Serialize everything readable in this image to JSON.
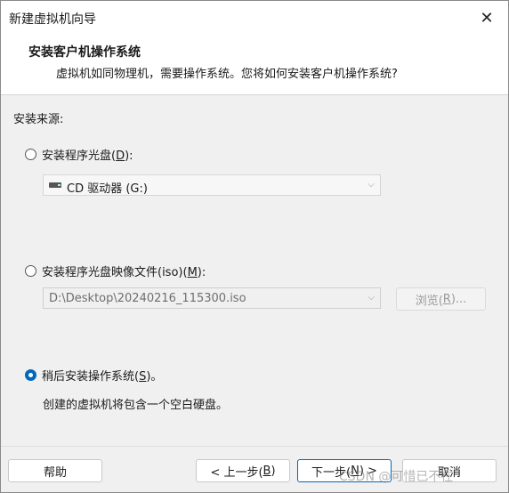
{
  "window": {
    "title": "新建虚拟机向导",
    "close_symbol": "✕"
  },
  "header": {
    "title": "安装客户机操作系统",
    "subtitle": "虚拟机如同物理机，需要操作系统。您将如何安装客户机操作系统?"
  },
  "source_label": "安装来源:",
  "options": {
    "disc": {
      "label_pre": "安装程序光盘(",
      "mnemonic": "D",
      "label_post": "):",
      "checked": false
    },
    "iso": {
      "label_pre": "安装程序光盘映像文件(iso)(",
      "mnemonic": "M",
      "label_post": "):",
      "checked": false
    },
    "later": {
      "label_pre": "稍后安装操作系统(",
      "mnemonic": "S",
      "label_post": ")。",
      "checked": true
    }
  },
  "disc_combo": {
    "value": "CD 驱动器 (G:)",
    "icon": "cd-drive-icon"
  },
  "iso_combo": {
    "value": "D:\\Desktop\\20240216_115300.iso"
  },
  "browse_button": {
    "label_pre": "浏览(",
    "mnemonic": "R",
    "label_post": ")..."
  },
  "later_description": "创建的虚拟机将包含一个空白硬盘。",
  "footer": {
    "help": "帮助",
    "back": {
      "label_pre": "< 上一步(",
      "mnemonic": "B",
      "label_post": ")"
    },
    "next": {
      "label_pre": "下一步(",
      "mnemonic": "N",
      "label_post": ") >"
    },
    "cancel": "取消"
  },
  "watermark": "CSDN @可惜已不在",
  "colors": {
    "accent": "#0067c0",
    "background": "#f0f0f0"
  }
}
